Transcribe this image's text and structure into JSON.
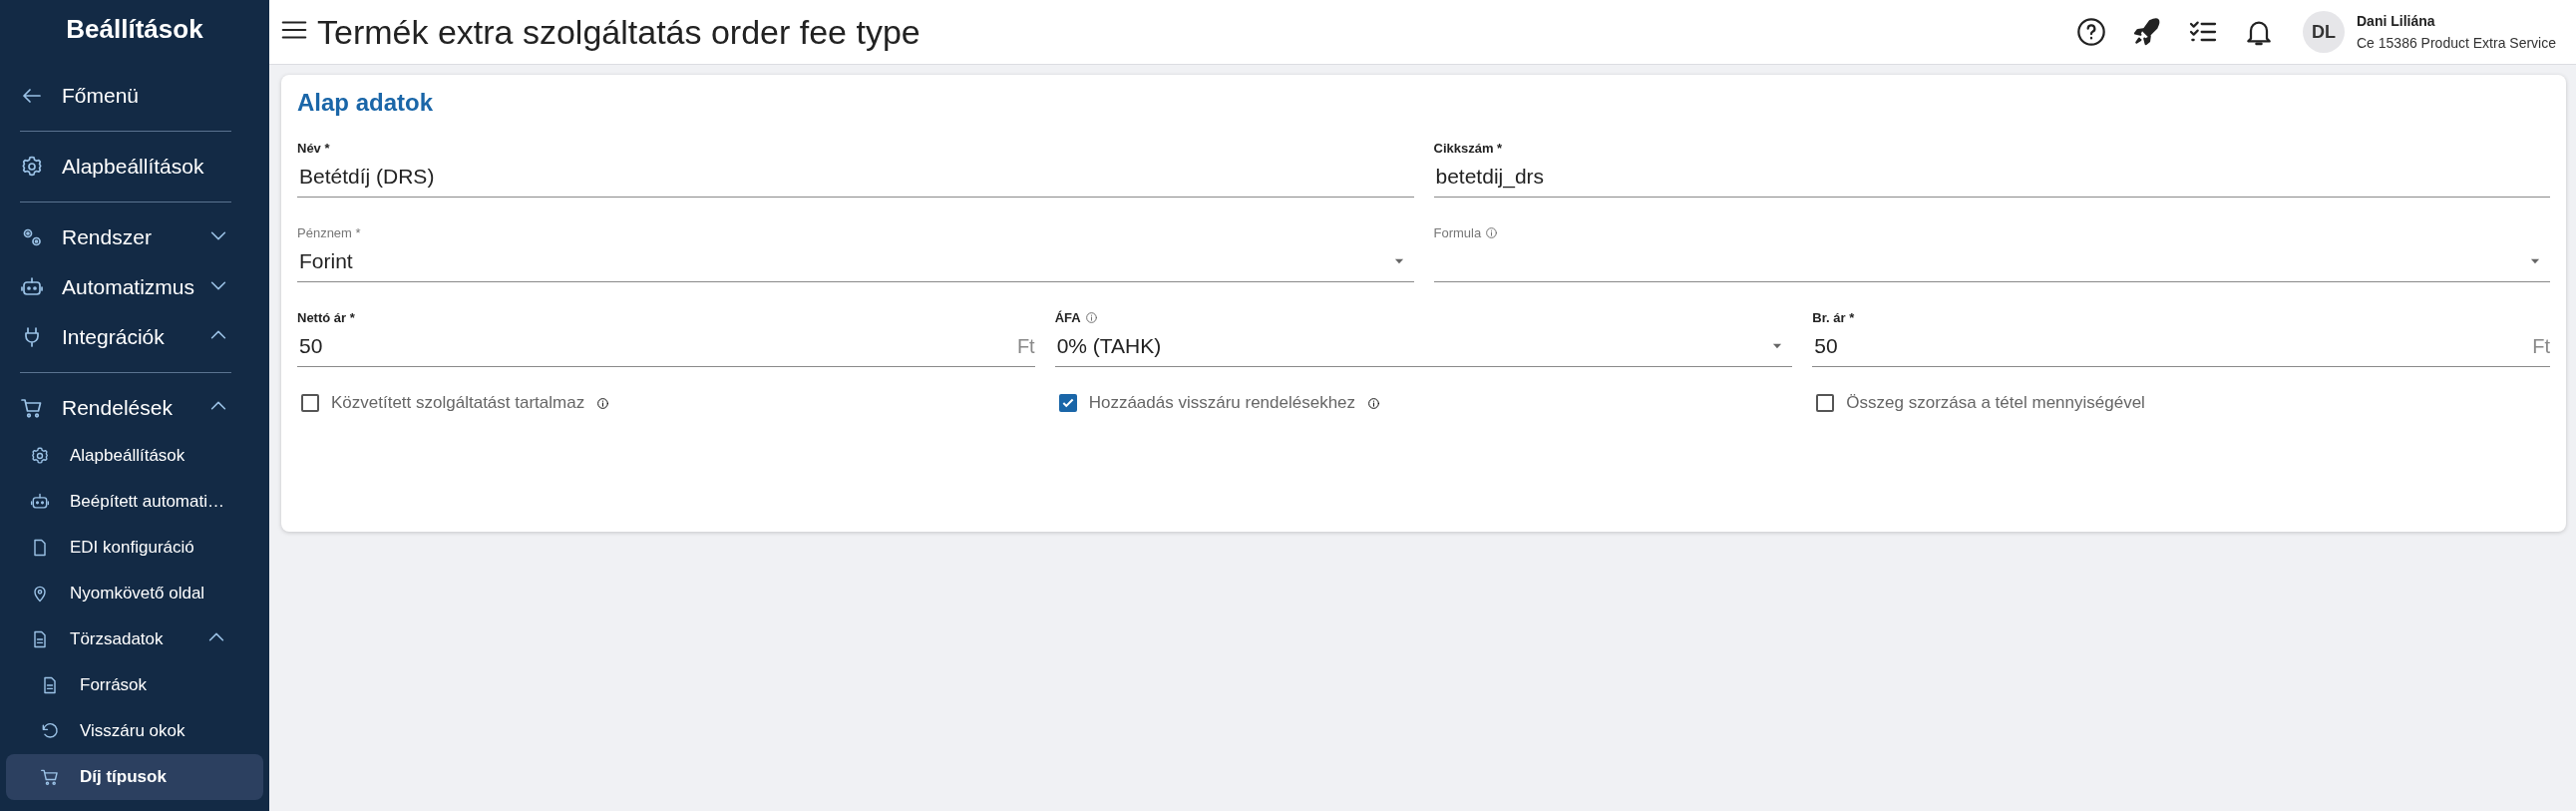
{
  "sidebar": {
    "title": "Beállítások",
    "groups": [
      {
        "items": [
          {
            "label": "Főmenü",
            "selected": false
          }
        ]
      },
      {
        "items": [
          {
            "label": "Alapbeállítások",
            "selected": false
          }
        ]
      },
      {
        "items": [
          {
            "label": "Rendszer",
            "selected": false,
            "expanded": false
          },
          {
            "label": "Automatizmus",
            "selected": false,
            "expanded": false
          },
          {
            "label": "Integrációk",
            "selected": false,
            "expanded": true
          }
        ]
      },
      {
        "items": [
          {
            "label": "Rendelések",
            "selected": false,
            "expanded": true,
            "children": [
              {
                "label": "Alapbeállítások",
                "selected": false
              },
              {
                "label": "Beépített automati…",
                "selected": false
              },
              {
                "label": "EDI konfiguráció",
                "selected": false
              },
              {
                "label": "Nyomkövető oldal",
                "selected": false
              },
              {
                "label": "Törzsadatok",
                "selected": false,
                "expanded": true,
                "children": [
                  {
                    "label": "Források",
                    "selected": false
                  },
                  {
                    "label": "Visszáru okok",
                    "selected": false
                  },
                  {
                    "label": "Díj típusok",
                    "selected": true
                  }
                ]
              }
            ]
          }
        ]
      }
    ]
  },
  "header": {
    "title": "Termék extra szolgáltatás order fee type",
    "user": {
      "initials": "DL",
      "name": "Dani Liliána",
      "subtitle": "Ce 15386 Product Extra Service"
    }
  },
  "card": {
    "title": "Alap adatok",
    "rows": [
      {
        "fields": [
          {
            "kind": "text",
            "label": "Név *",
            "label_bold": true,
            "info": false,
            "value": "Betétdíj (DRS)"
          },
          {
            "kind": "text",
            "label": "Cikkszám *",
            "label_bold": true,
            "info": false,
            "value": "betetdij_drs"
          }
        ]
      },
      {
        "fields": [
          {
            "kind": "select",
            "label": "Pénznem *",
            "label_bold": false,
            "info": false,
            "value": "Forint"
          },
          {
            "kind": "select",
            "label": "Formula",
            "label_bold": false,
            "info": true
          }
        ]
      },
      {
        "fields": [
          {
            "kind": "text",
            "label": "Nettó ár *",
            "label_bold": true,
            "info": false,
            "value": "50",
            "suffix": "Ft"
          },
          {
            "kind": "select",
            "label": "ÁFA",
            "label_bold": true,
            "info": true,
            "value": "0% (TAHK)"
          },
          {
            "kind": "text",
            "label": "Br. ár *",
            "label_bold": true,
            "info": false,
            "value": "50",
            "suffix": "Ft"
          }
        ]
      }
    ],
    "checks": [
      {
        "label": "Közvetített szolgáltatást tartalmaz",
        "checked": false,
        "info": true
      },
      {
        "label": "Hozzáadás visszáru rendelésekhez",
        "checked": true,
        "info": true
      },
      {
        "label": "Összeg szorzása a tétel mennyiségével",
        "checked": false,
        "info": false
      }
    ]
  }
}
